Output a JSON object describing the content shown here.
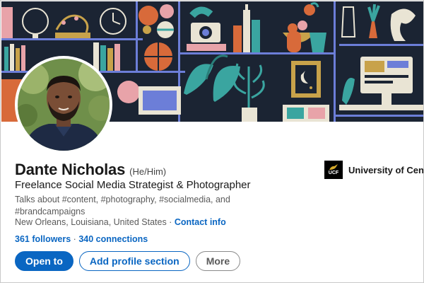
{
  "profile": {
    "name": "Dante Nicholas",
    "pronouns": "(He/Him)",
    "headline": "Freelance Social Media Strategist & Photographer",
    "talks_about": "Talks about #content, #photography, #socialmedia, and #brandcampaigns",
    "location": "New Orleans, Louisiana, United States",
    "location_separator": " · ",
    "contact_label": "Contact info",
    "followers": "361 followers",
    "stats_separator": " · ",
    "connections": "340 connections"
  },
  "actions": {
    "open_to": "Open to",
    "add_section": "Add profile section",
    "more": "More"
  },
  "education": {
    "logo_text": "UCF",
    "name": "University of Cent"
  },
  "colors": {
    "accent": "#0a66c2",
    "banner_bg": "#1b2433"
  }
}
